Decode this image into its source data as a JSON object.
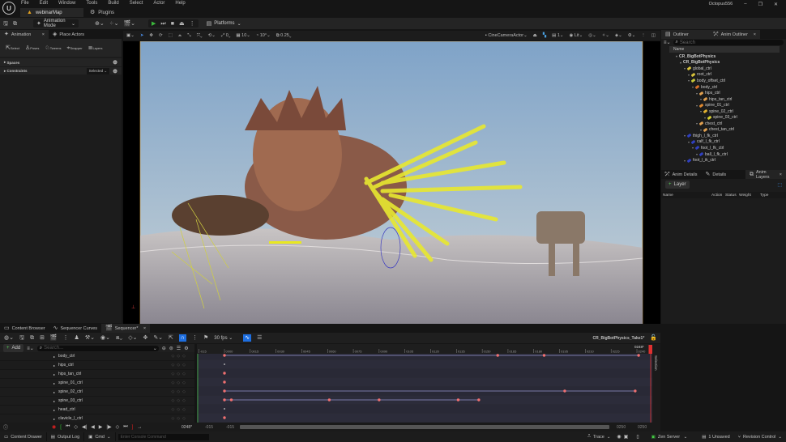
{
  "menu": [
    "File",
    "Edit",
    "Window",
    "Tools",
    "Build",
    "Select",
    "Actor",
    "Help"
  ],
  "doc_tabs": [
    {
      "label": "webinarMap",
      "icon": "level-icon"
    },
    {
      "label": "Plugins",
      "icon": "plugin-icon"
    }
  ],
  "window": {
    "user": "Octopus556",
    "minimize": "–",
    "maximize": "❐",
    "close": "✕"
  },
  "toolbar": {
    "mode": "Animation Mode",
    "platforms": "Platforms"
  },
  "left_panel": {
    "tabs": [
      "Animation",
      "Place Actors"
    ],
    "tools": [
      "Select",
      "Poses",
      "Tweens",
      "Snapper",
      "Layers"
    ],
    "sections": [
      {
        "label": "Spaces"
      },
      {
        "label": "Constraints",
        "dropdown": "Selected"
      }
    ]
  },
  "viewport_toolbar": {
    "snap_rot": "0",
    "grid": "10",
    "angle": "10°",
    "scale": "0.25",
    "camera": "CineCameraActor",
    "screen": "1",
    "view_mode": "Lit"
  },
  "outliner": {
    "tabs": [
      "Outliner",
      "Anim Outliner"
    ],
    "search_placeholder": "Search",
    "column": "Name",
    "items": [
      {
        "label": "CR_BigBotPhysics",
        "depth": 0,
        "bold": true,
        "color": ""
      },
      {
        "label": "CR_BigBotPhysics",
        "depth": 1,
        "bold": true,
        "color": ""
      },
      {
        "label": "global_ctrl",
        "depth": 2,
        "color": "#d8c23a"
      },
      {
        "label": "root_ctrl",
        "depth": 3,
        "color": "#d8c23a"
      },
      {
        "label": "body_offset_ctrl",
        "depth": 3,
        "color": "#c8c83a"
      },
      {
        "label": "body_ctrl",
        "depth": 4,
        "color": "#d8702a"
      },
      {
        "label": "hips_ctrl",
        "depth": 5,
        "color": "#e0a050"
      },
      {
        "label": "hips_tan_ctrl",
        "depth": 6,
        "color": "#e0a050"
      },
      {
        "label": "spine_01_ctrl",
        "depth": 5,
        "color": "#e08a30"
      },
      {
        "label": "spine_02_ctrl",
        "depth": 6,
        "color": "#e0b030"
      },
      {
        "label": "spine_03_ctrl",
        "depth": 7,
        "color": "#d8d030"
      },
      {
        "label": "chest_ctrl",
        "depth": 5,
        "color": "#e0a050"
      },
      {
        "label": "chest_tan_ctrl",
        "depth": 6,
        "color": "#e0a050"
      },
      {
        "label": "thigh_l_fk_ctrl",
        "depth": 2,
        "color": "#3040c0"
      },
      {
        "label": "calf_l_fk_ctrl",
        "depth": 3,
        "color": "#3040c0"
      },
      {
        "label": "foot_l_fk_ctrl",
        "depth": 4,
        "color": "#3040c0"
      },
      {
        "label": "ball_l_fk_ctrl",
        "depth": 5,
        "color": "#3040c0"
      },
      {
        "label": "foot_l_ik_ctrl",
        "depth": 2,
        "color": "#3040c0"
      }
    ]
  },
  "anim_layers": {
    "tabs": [
      "Anim Details",
      "Details",
      "Anim Layers"
    ],
    "add_layer": "Layer",
    "columns": [
      "Name",
      "Action",
      "Status",
      "Weight",
      "Type"
    ]
  },
  "bottom_tabs": [
    "Content Browser",
    "Sequencer Curves",
    "Sequencer*"
  ],
  "sequencer": {
    "fps": "30 fps",
    "sequence_name": "CR_BigBotPhysics_Take1*",
    "add": "Add",
    "search_placeholder": "Search...",
    "current_frame": "0248*",
    "playhead_label": "0248*",
    "range_start": "-015",
    "range_start2": "-015",
    "range_end": "0250",
    "range_end2": "0250",
    "selection_label": "Selection",
    "ticks": [
      "-015",
      "0000",
      "0015",
      "0030",
      "0045",
      "0060",
      "0075",
      "0090",
      "0105",
      "0120",
      "0135",
      "0150",
      "0165",
      "0180",
      "0195",
      "0210",
      "0225",
      "0240"
    ],
    "tracks": [
      {
        "label": "body_ctrl",
        "keys": [
          0,
          159,
          186,
          241
        ],
        "line": true
      },
      {
        "label": "hips_ctrl",
        "keys": [
          0
        ],
        "line": false,
        "small": true
      },
      {
        "label": "hips_tan_ctrl",
        "keys": [
          0
        ],
        "line": false
      },
      {
        "label": "spine_01_ctrl",
        "keys": [
          0
        ],
        "line": false
      },
      {
        "label": "spine_02_ctrl",
        "keys": [
          0,
          198,
          239
        ],
        "line": true
      },
      {
        "label": "spine_03_ctrl",
        "keys": [
          0,
          4,
          61,
          90,
          136,
          148
        ],
        "line": true
      },
      {
        "label": "head_ctrl",
        "keys": [
          0
        ],
        "line": false,
        "small": true
      },
      {
        "label": "clavicle_l_ctrl",
        "keys": [
          0
        ],
        "line": false
      }
    ],
    "playhead_frame": 248
  },
  "statusbar": {
    "content_drawer": "Content Drawer",
    "output_log": "Output Log",
    "cmd": "Cmd",
    "console_placeholder": "Enter Console Command",
    "trace": "Trace",
    "zen": "Zen Server",
    "unsaved": "1 Unsaved",
    "revision": "Revision Control"
  }
}
